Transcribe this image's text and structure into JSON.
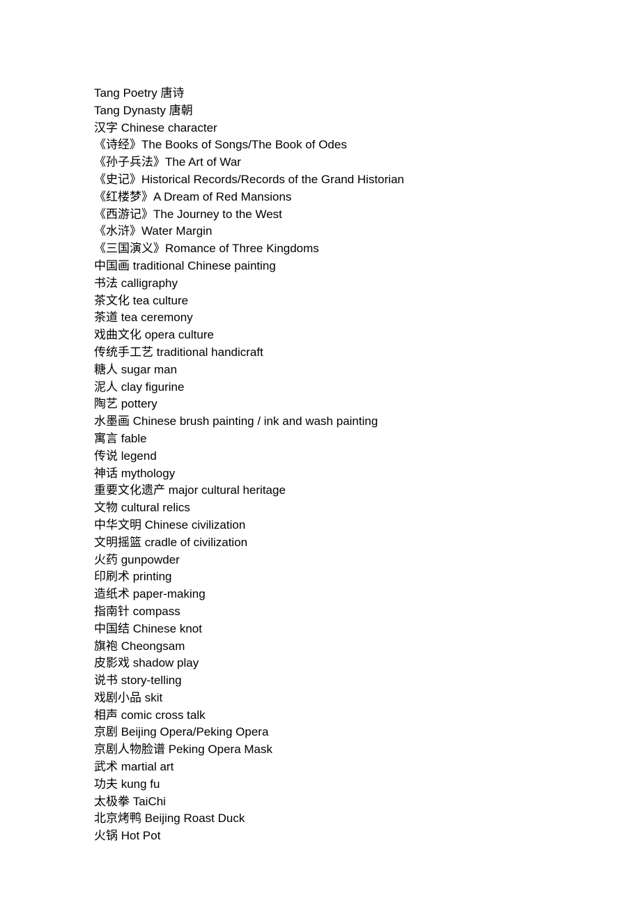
{
  "items": [
    {
      "text": "Tang Poetry 唐诗"
    },
    {
      "text": "Tang Dynasty 唐朝"
    },
    {
      "text": "汉字 Chinese character"
    },
    {
      "text": "《诗经》The Books of Songs/The Book of Odes"
    },
    {
      "text": "《孙子兵法》The Art of War"
    },
    {
      "text": "《史记》Historical Records/Records of the Grand Historian"
    },
    {
      "text": "《红楼梦》A Dream of Red Mansions"
    },
    {
      "text": "《西游记》The Journey to the West"
    },
    {
      "text": "《水浒》Water Margin"
    },
    {
      "text": "《三国演义》Romance of Three Kingdoms"
    },
    {
      "text": "中国画 traditional Chinese painting"
    },
    {
      "text": "书法 calligraphy"
    },
    {
      "text": "茶文化 tea culture"
    },
    {
      "text": "茶道 tea ceremony"
    },
    {
      "text": "戏曲文化 opera culture"
    },
    {
      "text": "传统手工艺 traditional handicraft"
    },
    {
      "text": "糖人 sugar man"
    },
    {
      "text": "泥人 clay figurine"
    },
    {
      "text": "陶艺 pottery"
    },
    {
      "text": "水墨画 Chinese brush painting / ink and wash painting"
    },
    {
      "text": "寓言 fable"
    },
    {
      "text": "传说 legend"
    },
    {
      "text": "神话 mythology"
    },
    {
      "text": "重要文化遗产 major cultural heritage"
    },
    {
      "text": "文物 cultural relics"
    },
    {
      "text": "中华文明 Chinese civilization"
    },
    {
      "text": "文明摇篮 cradle of civilization"
    },
    {
      "text": "火药 gunpowder"
    },
    {
      "text": "印刷术 printing"
    },
    {
      "text": "造纸术 paper-making"
    },
    {
      "text": "指南针 compass"
    },
    {
      "text": "中国结 Chinese knot"
    },
    {
      "text": "旗袍 Cheongsam"
    },
    {
      "text": "皮影戏 shadow play"
    },
    {
      "text": "说书 story-telling"
    },
    {
      "text": "戏剧小品 skit"
    },
    {
      "text": "相声 comic cross talk"
    },
    {
      "text": "京剧 Beijing Opera/Peking Opera"
    },
    {
      "text": "京剧人物脸谱 Peking Opera Mask"
    },
    {
      "text": "武术 martial art"
    },
    {
      "text": "功夫 kung fu"
    },
    {
      "text": "太极拳 TaiChi"
    },
    {
      "text": "北京烤鸭 Beijing Roast Duck"
    },
    {
      "text": "火锅 Hot Pot"
    }
  ]
}
